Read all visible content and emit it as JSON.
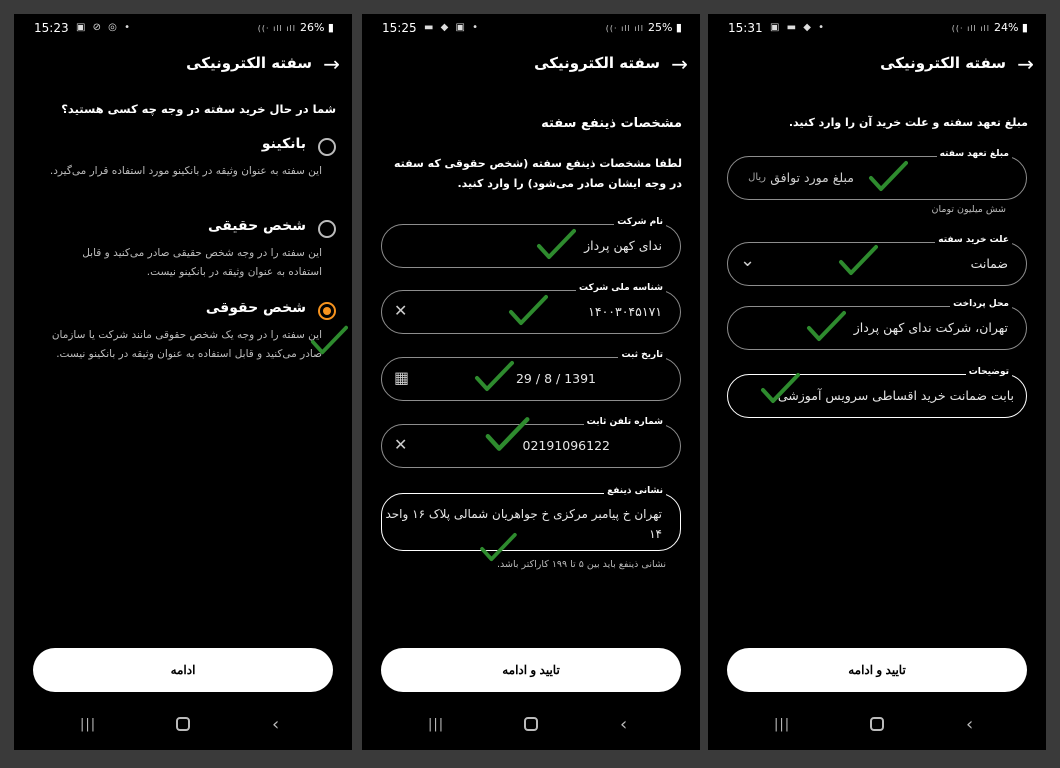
{
  "colors": {
    "accent": "#f7931e",
    "check": "#2e8b2e"
  },
  "screen1": {
    "status": {
      "time": "15:23",
      "battery": "26%"
    },
    "title": "سفته الکترونیکی",
    "question": "شما در حال خرید سفته در وجه چه کسی هستید؟",
    "options": [
      {
        "title": "بانکینو",
        "desc": "این سفته به عنوان وثیقه در بانکینو مورد استفاده قرار می‌گیرد."
      },
      {
        "title": "شخص حقیقی",
        "desc": "این سفته را در وجه شخص حقیقی صادر می‌کنید و قابل استفاده به عنوان وثیقه در بانکینو نیست."
      },
      {
        "title": "شخص حقوقی",
        "desc": "این سفته را در وجه یک شخص حقوقی مانند شرکت یا سازمان صادر می‌کنید و قابل استفاده به عنوان وثیقه در بانکینو نیست."
      }
    ],
    "button": "ادامه"
  },
  "screen2": {
    "status": {
      "time": "15:25",
      "battery": "25%"
    },
    "title": "سفته الکترونیکی",
    "section_title": "مشخصات ذینفع سفته",
    "instruction": "لطفا مشخصات ذینفع سفته (شخص حقوقی که سفته در وجه ایشان صادر می‌شود) را وارد کنید.",
    "fields": [
      {
        "label": "نام شرکت",
        "value": "ندای کهن پرداز"
      },
      {
        "label": "شناسه ملی شرکت",
        "value": "۱۴۰۰۳۰۴۵۱۷۱"
      },
      {
        "label": "تاریخ ثبت",
        "value": "1391 / 8 / 29"
      },
      {
        "label": "شماره تلفن ثابت",
        "value": "02191096122"
      },
      {
        "label": "نشانی ذینفع",
        "value": "تهران خ پیامبر مرکزی خ جواهریان شمالی پلاک ۱۶ واحد ۱۴"
      }
    ],
    "hint": "نشانی ذینفع باید بین ۵ تا ۱۹۹ کاراکتر باشد.",
    "button": "تایید و ادامه"
  },
  "screen3": {
    "status": {
      "time": "15:31",
      "battery": "24%"
    },
    "title": "سفته الکترونیکی",
    "instruction": "مبلغ تعهد سفته و علت خرید آن را وارد کنید.",
    "fields": [
      {
        "label": "مبلغ تعهد سفته",
        "value": "مبلغ مورد توافق",
        "suffix": "ریال"
      },
      {
        "label": "علت خرید سفته",
        "value": "ضمانت"
      },
      {
        "label": "محل پرداخت",
        "value": "تهران، شرکت ندای کهن پرداز"
      },
      {
        "label": "توضیحات",
        "value": "بابت ضمانت خرید اقساطی سرویس آموزشی"
      }
    ],
    "amount_words": "شش میلیون تومان",
    "button": "تایید و ادامه"
  },
  "icons": [
    "back-arrow-icon",
    "radio-icon",
    "clear-x-icon",
    "calendar-icon",
    "chevron-down-icon",
    "checkmark-icon"
  ]
}
